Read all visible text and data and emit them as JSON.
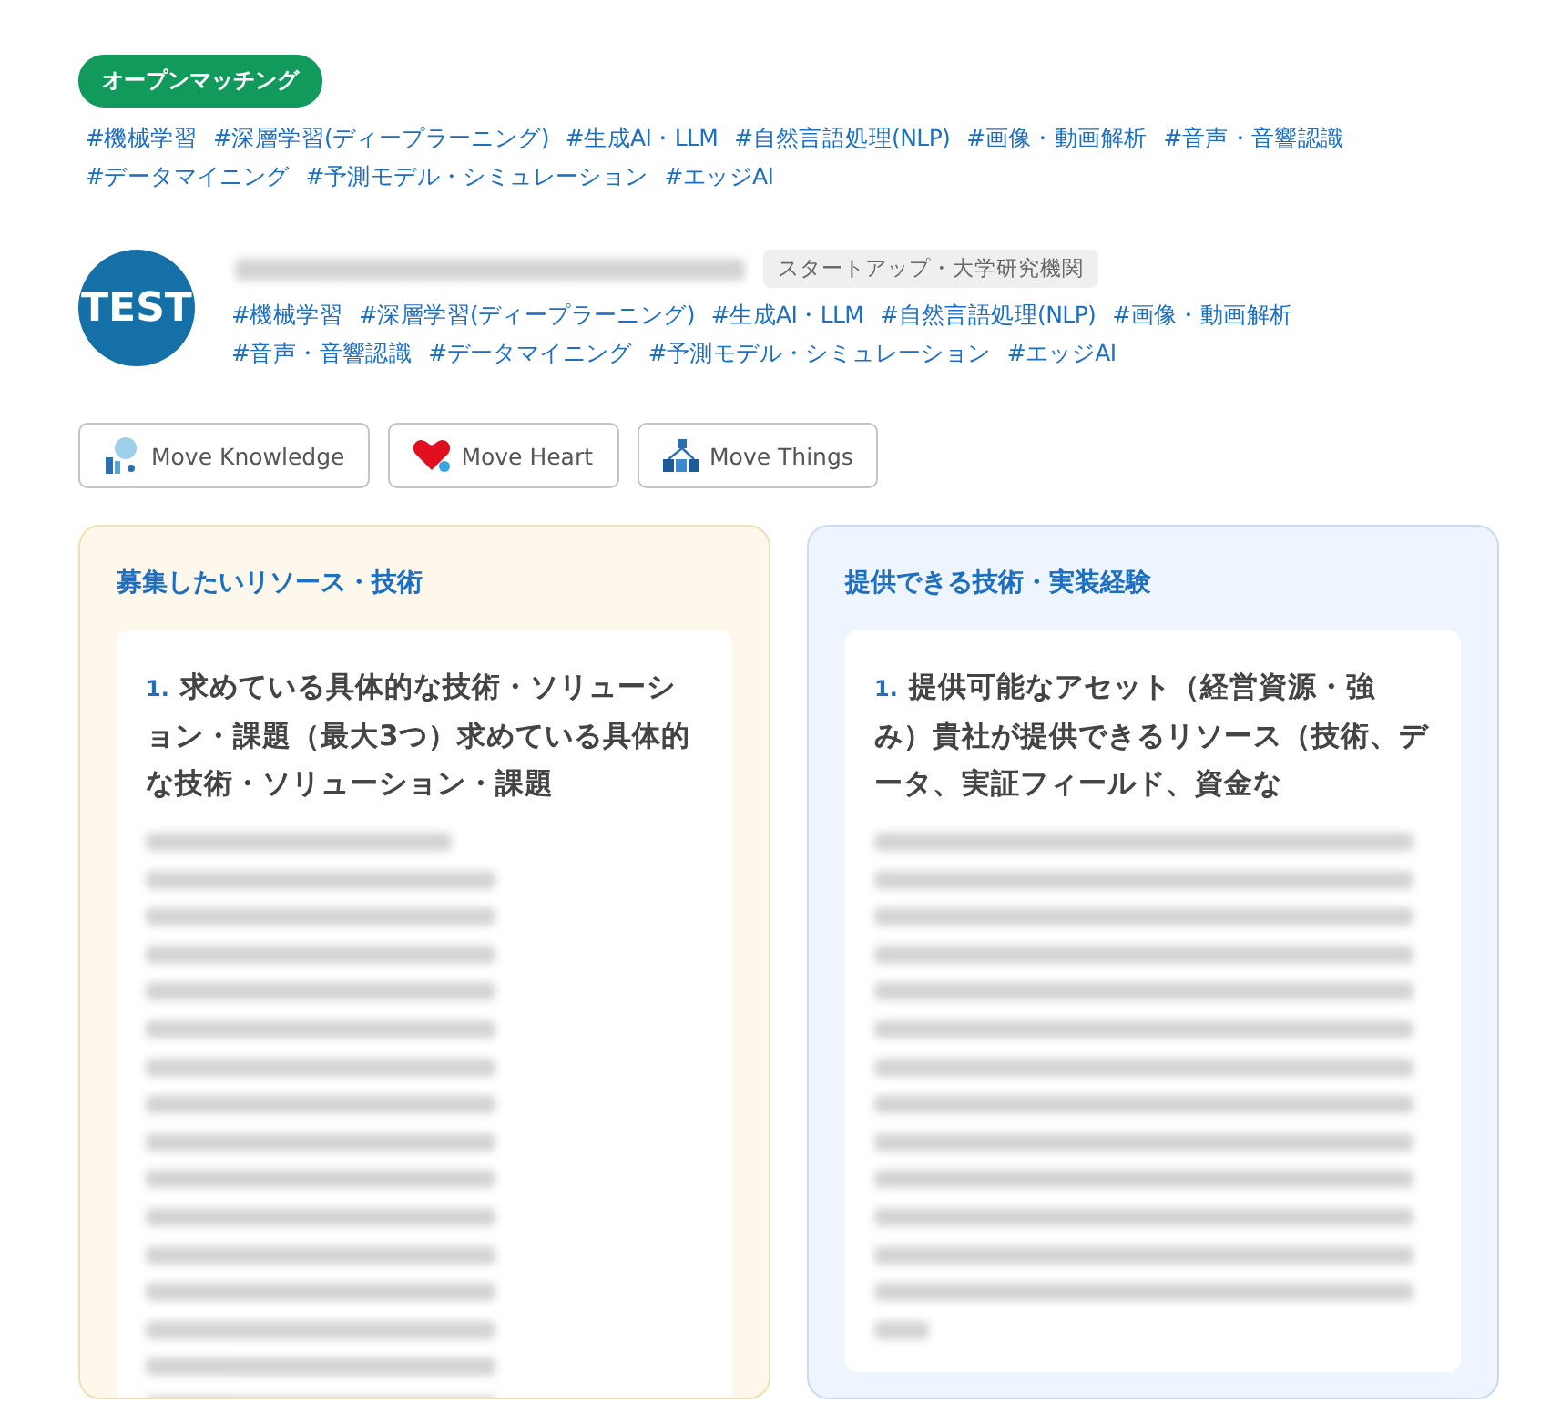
{
  "status_badge": "オープンマッチング",
  "tags": [
    "#機械学習",
    "#深層学習(ディープラーニング)",
    "#生成AI・LLM",
    "#自然言語処理(NLP)",
    "#画像・動画解析",
    "#音声・音響認識",
    "#データマイニング",
    "#予測モデル・シミュレーション",
    "#エッジAI"
  ],
  "company": {
    "avatar_text": "TEST",
    "category": "スタートアップ・大学研究機関",
    "tags": [
      "#機械学習",
      "#深層学習(ディープラーニング)",
      "#生成AI・LLM",
      "#自然言語処理(NLP)",
      "#画像・動画解析",
      "#音声・音響認識",
      "#データマイニング",
      "#予測モデル・シミュレーション",
      "#エッジAI"
    ]
  },
  "move_buttons": [
    {
      "kind": "knowledge",
      "label": "Move Knowledge"
    },
    {
      "kind": "heart",
      "label": "Move Heart"
    },
    {
      "kind": "things",
      "label": "Move Things"
    }
  ],
  "panels": [
    {
      "kind": "seek",
      "title": "募集したいリソース・技術",
      "items": [
        {
          "number": "1.",
          "heading": "求めている具体的な技術・ソリューション・課題（最大3つ）求めている具体的な技術・ソリューション・課題"
        }
      ]
    },
    {
      "kind": "offer",
      "title": "提供できる技術・実装経験",
      "items": [
        {
          "number": "1.",
          "heading": "提供可能なアセット（経営資源・強み）貴社が提供できるリソース（技術、データ、実証フィールド、資金な"
        }
      ]
    }
  ]
}
